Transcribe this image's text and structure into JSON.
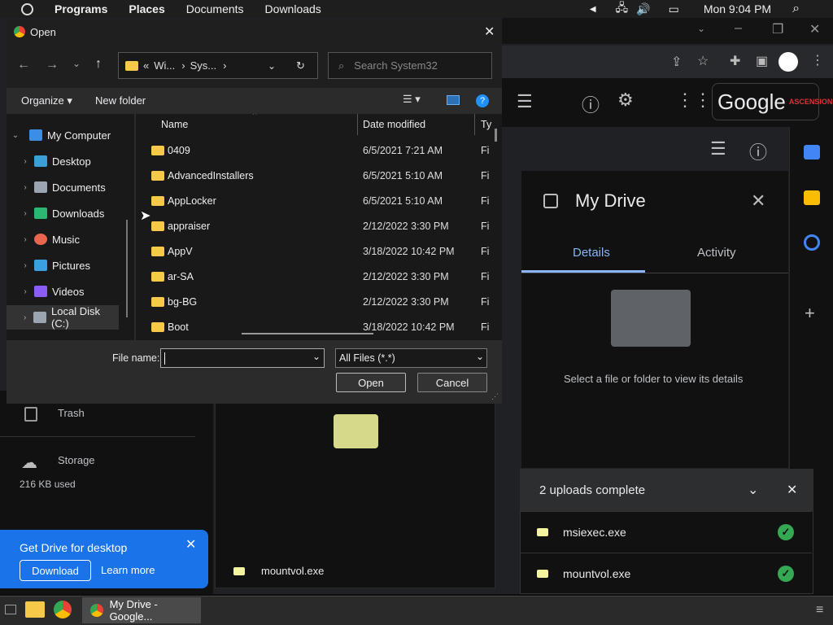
{
  "top_panel": {
    "menu": [
      "Programs",
      "Places",
      "Documents",
      "Downloads"
    ],
    "clock": "Mon 9:04 PM"
  },
  "drive": {
    "details_title": "My Drive",
    "tabs": [
      "Details",
      "Activity"
    ],
    "empty_text": "Select a file or folder to view its details",
    "trash_label": "Trash",
    "storage_label": "Storage",
    "storage_used": "216 KB used",
    "main_file": "mountvol.exe",
    "upload_title": "2 uploads complete",
    "uploads": [
      "msiexec.exe",
      "mountvol.exe"
    ],
    "promo_title": "Get Drive for desktop",
    "promo_download": "Download",
    "promo_learn": "Learn more",
    "google_logo": "Google",
    "org_logo": "ASCENSION"
  },
  "taskbar": {
    "window_label": "My Drive - Google..."
  },
  "dialog": {
    "title": "Open",
    "breadcrumb": [
      "«",
      "Wi...",
      "›",
      "Sys...",
      "›"
    ],
    "search_placeholder": "Search System32",
    "organize": "Organize",
    "new_folder": "New folder",
    "columns": {
      "name": "Name",
      "date": "Date modified",
      "type": "Ty"
    },
    "tree": [
      {
        "label": "My Computer",
        "color": "#3a8ee6"
      },
      {
        "label": "Desktop",
        "color": "#3ba0d8"
      },
      {
        "label": "Documents",
        "color": "#9aa5b1"
      },
      {
        "label": "Downloads",
        "color": "#2bb673"
      },
      {
        "label": "Music",
        "color": "#e8654f"
      },
      {
        "label": "Pictures",
        "color": "#3aa0e0"
      },
      {
        "label": "Videos",
        "color": "#8b5cf6"
      },
      {
        "label": "Local Disk (C:)",
        "color": "#9aa5b1"
      }
    ],
    "files": [
      {
        "name": "0409",
        "date": "6/5/2021 7:21 AM",
        "type": "Fi"
      },
      {
        "name": "AdvancedInstallers",
        "date": "6/5/2021 5:10 AM",
        "type": "Fi"
      },
      {
        "name": "AppLocker",
        "date": "6/5/2021 5:10 AM",
        "type": "Fi"
      },
      {
        "name": "appraiser",
        "date": "2/12/2022 3:30 PM",
        "type": "Fi"
      },
      {
        "name": "AppV",
        "date": "3/18/2022 10:42 PM",
        "type": "Fi"
      },
      {
        "name": "ar-SA",
        "date": "2/12/2022 3:30 PM",
        "type": "Fi"
      },
      {
        "name": "bg-BG",
        "date": "2/12/2022 3:30 PM",
        "type": "Fi"
      },
      {
        "name": "Boot",
        "date": "3/18/2022 10:42 PM",
        "type": "Fi"
      }
    ],
    "file_name_label": "File name:",
    "file_name_value": "",
    "filter": "All Files (*.*)",
    "open_button": "Open",
    "cancel_button": "Cancel"
  }
}
